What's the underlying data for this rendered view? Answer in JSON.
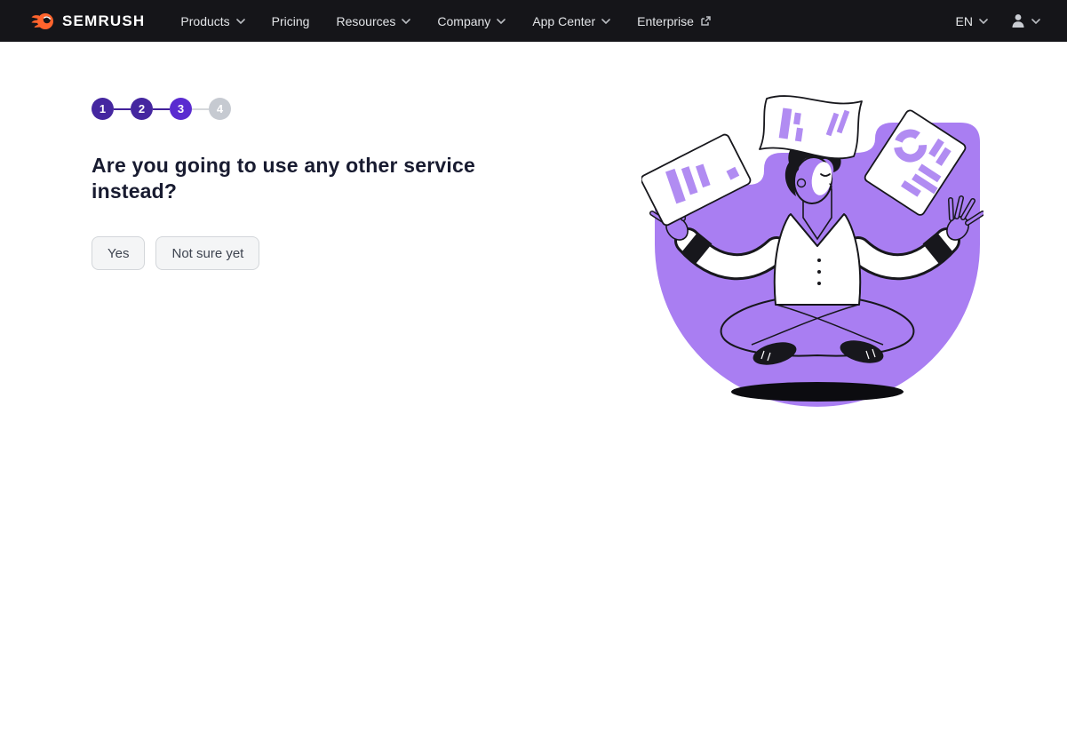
{
  "nav": {
    "brand": "SEMRUSH",
    "items": [
      {
        "label": "Products",
        "dropdown": true,
        "external": false
      },
      {
        "label": "Pricing",
        "dropdown": false,
        "external": false
      },
      {
        "label": "Resources",
        "dropdown": true,
        "external": false
      },
      {
        "label": "Company",
        "dropdown": true,
        "external": false
      },
      {
        "label": "App Center",
        "dropdown": true,
        "external": false
      },
      {
        "label": "Enterprise",
        "dropdown": false,
        "external": true
      }
    ],
    "language": "EN"
  },
  "stepper": {
    "steps": [
      {
        "number": "1",
        "state": "done"
      },
      {
        "number": "2",
        "state": "done"
      },
      {
        "number": "3",
        "state": "active"
      },
      {
        "number": "4",
        "state": "upcoming"
      }
    ]
  },
  "main": {
    "question_lines": [
      "Are you going to use any other service",
      "instead?"
    ],
    "buttons": {
      "yes": "Yes",
      "not_sure": "Not sure yet"
    }
  },
  "illustration": {
    "description": "Person meditating cross-legged on purple backdrop with floating documents"
  },
  "colors": {
    "nav_bg": "#151519",
    "brand_orange": "#ff642d",
    "step_done": "#4527a0",
    "step_active": "#5a2bd0",
    "step_upcoming": "#c6cad1",
    "illustration_purple": "#a97ef2",
    "paper_mark_purple": "#b18cf2",
    "heading_text": "#181b30"
  }
}
